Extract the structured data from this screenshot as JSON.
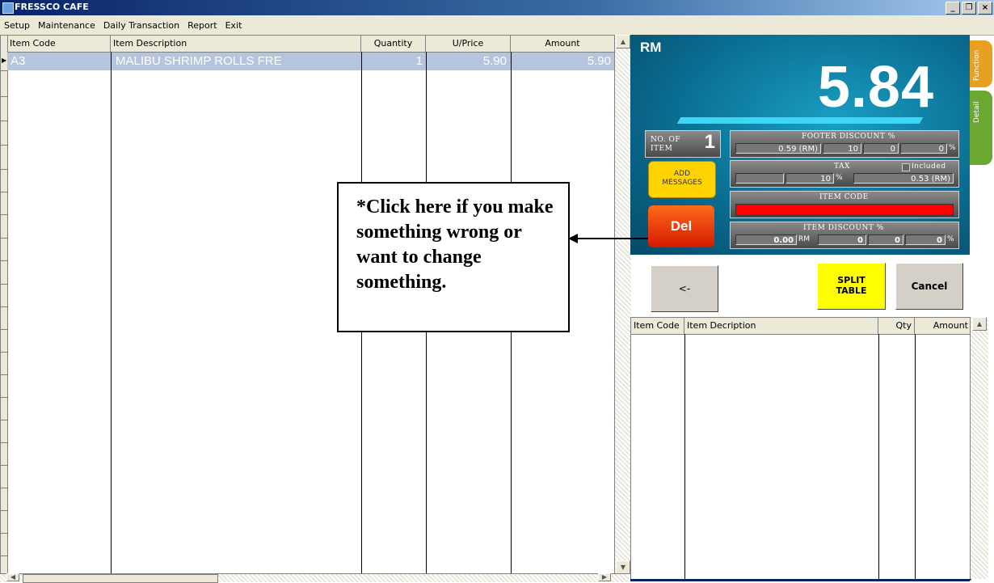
{
  "app": {
    "title": "FRESSCO CAFE"
  },
  "window_buttons": [
    "_",
    "ฟ",
    "×"
  ],
  "menu": [
    "Setup",
    "Maintenance",
    "Daily Transaction",
    "Report",
    "Exit"
  ],
  "main_grid": {
    "columns": [
      "Item Code",
      "Item Description",
      "Quantity",
      "U/Price",
      "Amount"
    ],
    "rows": [
      {
        "code": "A3",
        "description": "MALIBU SHRIMP ROLLS FRE",
        "quantity": "1",
        "unit_price": "5.90",
        "amount": "5.90"
      }
    ]
  },
  "summary": {
    "currency": "RM",
    "total": "5.84",
    "no_of_item_label_1": "NO. OF",
    "no_of_item_label_2": "ITEM",
    "no_of_item": "1",
    "footer_discount_label": "FOOTER DISCOUNT %",
    "footer_discount": [
      "0.59 (RM)",
      "10",
      "0",
      "0"
    ],
    "footer_discount_pct": "%",
    "tax_label": "TAX",
    "tax_included_label": "Included",
    "tax": [
      "",
      "10",
      "0.53 (RM)"
    ],
    "tax_pct": "%",
    "item_code_label": "ITEM CODE",
    "item_discount_label": "ITEM DISCOUNT %",
    "item_discount_amount": "0.00",
    "item_discount_rm": "RM",
    "item_discount": [
      "0",
      "0",
      "0"
    ],
    "item_discount_pct": "%"
  },
  "buttons": {
    "add_messages_1": "ADD",
    "add_messages_2": "MESSAGES",
    "del": "Del",
    "back": "<-",
    "split_table_1": "SPLIT",
    "split_table_2": "TABLE",
    "cancel": "Cancel"
  },
  "side_tabs": {
    "function": "Function",
    "detail": "Detail"
  },
  "split_grid": {
    "columns": [
      "Item Code",
      "Item Decription",
      "Qty",
      "Amount"
    ]
  },
  "callout": {
    "text": "*Click here if you make something wrong or want to change something."
  },
  "colors": {
    "panel": "#0a6e93",
    "total_text": "#ffffff",
    "yellow_button": "#ffd400",
    "del_button": "#e0300a",
    "item_code_field": "#ff0000",
    "selected_row": "#b6c4de"
  }
}
